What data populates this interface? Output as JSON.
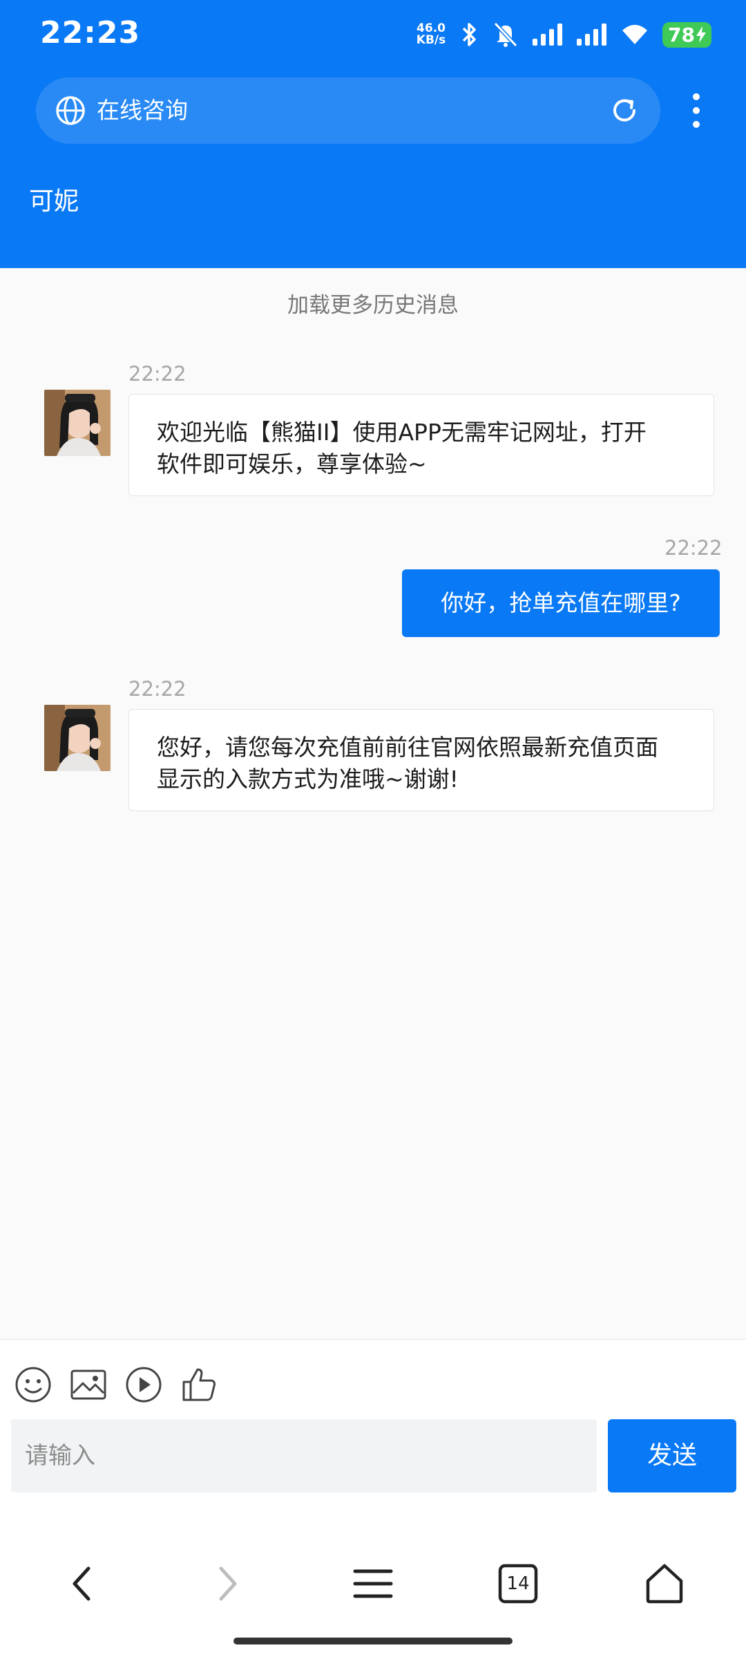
{
  "status_bar": {
    "time": "22:23",
    "net_speed_value": "46.0",
    "net_speed_unit": "KB/s",
    "battery": "78"
  },
  "browser": {
    "url_text": "在线咨询"
  },
  "chat": {
    "agent_name": "可妮",
    "load_more": "加载更多历史消息",
    "messages": [
      {
        "from": "agent",
        "time": "22:22",
        "lines": [
          "欢迎光临【熊猫II】使用APP无需牢记网址，打开",
          "软件即可娱乐，尊享体验~"
        ]
      },
      {
        "from": "user",
        "time": "22:22",
        "text": "你好，抢单充值在哪里?"
      },
      {
        "from": "agent",
        "time": "22:22",
        "lines": [
          "您好，请您每次充值前前往官网依照最新充值页面",
          "显示的入款方式为准哦~谢谢!"
        ]
      }
    ]
  },
  "composer": {
    "placeholder": "请输入",
    "send_label": "发送",
    "tools": [
      "emoji-icon",
      "image-icon",
      "video-icon",
      "thumbs-up-icon"
    ]
  },
  "nav": {
    "tab_count": "14"
  },
  "colors": {
    "brand_blue": "#0a79f5",
    "battery_green": "#3fc957"
  }
}
